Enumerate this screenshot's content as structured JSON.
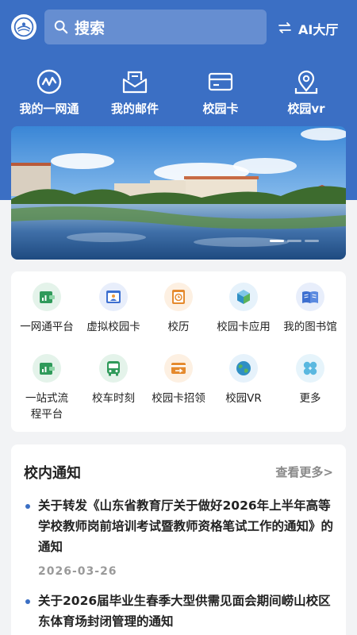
{
  "header": {
    "search_placeholder": "搜索",
    "ai_hall_label": "AI大厅"
  },
  "quick_actions": [
    {
      "label": "我的一网通",
      "icon": "pulse-circle-icon"
    },
    {
      "label": "我的邮件",
      "icon": "mail-tray-icon"
    },
    {
      "label": "校园卡",
      "icon": "card-icon"
    },
    {
      "label": "校园vr",
      "icon": "location-pin-icon"
    }
  ],
  "banner": {
    "slide_count": 3,
    "active_slide": 1
  },
  "apps": [
    {
      "label": "一网通平台",
      "icon": "wallet-chart-icon"
    },
    {
      "label": "虚拟校园卡",
      "icon": "virtual-card-icon"
    },
    {
      "label": "校历",
      "icon": "calendar-clock-icon"
    },
    {
      "label": "校园卡应用",
      "icon": "cube-icon"
    },
    {
      "label": "我的图书馆",
      "icon": "open-book-icon"
    },
    {
      "label": "一站式流程平台",
      "icon": "wallet-chart-icon"
    },
    {
      "label": "校车时刻",
      "icon": "bus-icon"
    },
    {
      "label": "校园卡招领",
      "icon": "card-return-icon"
    },
    {
      "label": "校园VR",
      "icon": "globe-icon"
    },
    {
      "label": "更多",
      "icon": "clover-icon"
    }
  ],
  "notices": {
    "title": "校内通知",
    "more_label": "查看更多>",
    "items": [
      {
        "text": "关于转发《山东省教育厅关于做好2026年上半年高等学校教师岗前培训考试暨教师资格笔试工作的通知》的通知",
        "date": "2026-03-26"
      },
      {
        "text": "关于2026届毕业生春季大型供需见面会期间崂山校区东体育场封闭管理的通知",
        "date": ""
      }
    ]
  },
  "colors": {
    "brand_blue": "#3b6fc4",
    "page_bg": "#f2f3f5"
  }
}
